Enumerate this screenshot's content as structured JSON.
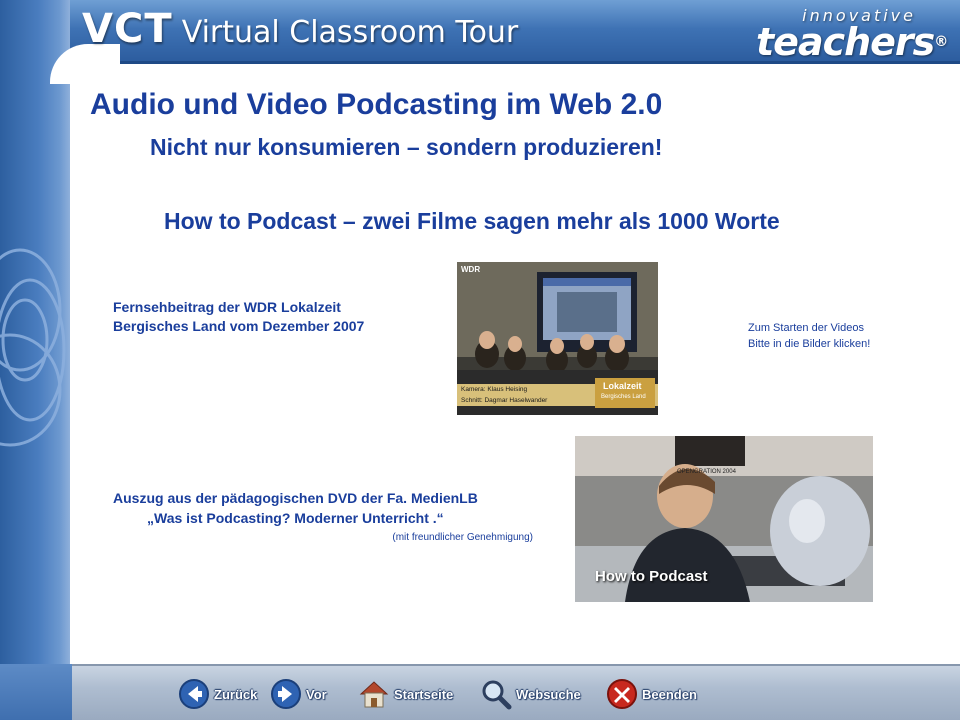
{
  "header": {
    "app_abbr": "VCT",
    "app_name": "Virtual Classroom Tour",
    "brand_small": "innovative",
    "brand_big": "teachers",
    "brand_mark": "®"
  },
  "content": {
    "title": "Audio und Video Podcasting im Web 2.0",
    "subtitle": "Nicht nur konsumieren – sondern produzieren!",
    "heading": "How to Podcast – zwei Filme sagen mehr als 1000 Worte",
    "video1": {
      "caption_line1": "Fernsehbeitrag der WDR Lokalzeit",
      "caption_line2": "Bergisches Land vom Dezember 2007",
      "logo": "WDR",
      "lower_third": "Lokalzeit",
      "lower_third_sub": "Bergisches Land",
      "credit1": "Kamera: Klaus Heising",
      "credit2": "Schnitt: Dagmar Haselwander"
    },
    "hint_line1": "Zum Starten der Videos",
    "hint_line2": "Bitte in die Bilder klicken!",
    "video2": {
      "caption_line1": "Auszug aus der pädagogischen DVD der Fa. MedienLB",
      "caption_line2": "„Was ist Podcasting? Moderner Unterricht .“",
      "caption_line3": "(mit freundlicher Genehmigung)",
      "overlay": "How to Podcast",
      "poster": "OPENGRATION 2004"
    }
  },
  "nav": {
    "back": "Zurück",
    "forward": "Vor",
    "home": "Startseite",
    "search": "Websuche",
    "quit": "Beenden"
  },
  "colors": {
    "frame_blue": "#3e72b4",
    "text_blue": "#1a3e9c",
    "nav_bar": "#aebdd0"
  },
  "icons": [
    "back-arrow-icon",
    "forward-arrow-icon",
    "home-icon",
    "magnifier-icon",
    "close-x-icon"
  ]
}
